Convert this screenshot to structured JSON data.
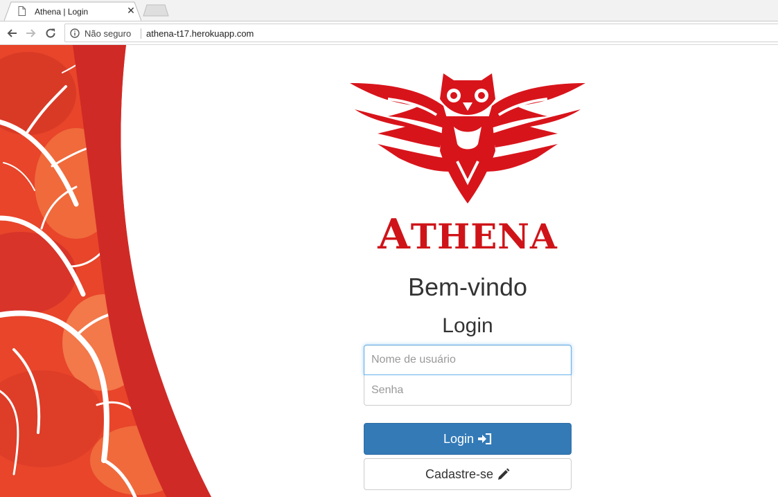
{
  "browser": {
    "tab_title": "Athena | Login",
    "tab_icon": "page-icon",
    "security_label": "Não seguro",
    "url": "athena-t17.herokuapp.com"
  },
  "page": {
    "brand": "Athena",
    "brand_first": "A",
    "brand_rest": "THENA",
    "welcome": "Bem-vindo",
    "login_heading": "Login",
    "username_placeholder": "Nome de usuário",
    "password_placeholder": "Senha",
    "login_button": "Login",
    "register_button": "Cadastre-se",
    "brand_color": "#cf1419",
    "primary_color": "#337ab7"
  }
}
